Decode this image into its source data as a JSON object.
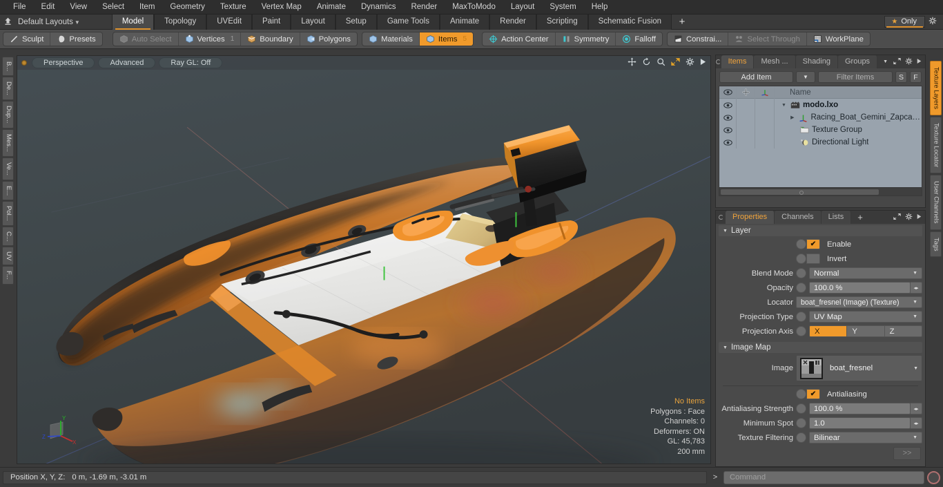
{
  "menubar": {
    "items": [
      "File",
      "Edit",
      "View",
      "Select",
      "Item",
      "Geometry",
      "Texture",
      "Vertex Map",
      "Animate",
      "Dynamics",
      "Render",
      "MaxToModo",
      "Layout",
      "System",
      "Help"
    ]
  },
  "layoutbar": {
    "home_icon": "home-icon",
    "layout_name": "Default Layouts",
    "tabs": [
      "Model",
      "Topology",
      "UVEdit",
      "Paint",
      "Layout",
      "Setup",
      "Game Tools",
      "Animate",
      "Render",
      "Scripting",
      "Schematic Fusion"
    ],
    "active_tab": "Model",
    "plus_label": "+",
    "only_label": "Only",
    "gear_icon": "gear-icon"
  },
  "modebar": {
    "left_group": [
      {
        "label": "Sculpt",
        "icon": "brush-icon",
        "state": "normal"
      },
      {
        "label": "Presets",
        "icon": "sphere-icon",
        "state": "normal"
      }
    ],
    "select_group": [
      {
        "label": "Auto Select",
        "icon": "cube-gray-icon",
        "state": "dim",
        "num": ""
      },
      {
        "label": "Vertices",
        "icon": "cube-vertex-icon",
        "state": "normal",
        "num": "1"
      },
      {
        "label": "Boundary",
        "icon": "cube-edge-icon",
        "state": "normal",
        "num": ""
      },
      {
        "label": "Polygons",
        "icon": "cube-poly-icon",
        "state": "normal",
        "num": ""
      }
    ],
    "item_group": [
      {
        "label": "Materials",
        "icon": "cube-mat-icon",
        "state": "normal",
        "num": ""
      },
      {
        "label": "Items",
        "icon": "cube-item-icon",
        "state": "on",
        "num": "5"
      }
    ],
    "tool_group": [
      {
        "label": "Action Center",
        "icon": "action-center-icon",
        "state": "normal"
      },
      {
        "label": "Symmetry",
        "icon": "symmetry-icon",
        "state": "normal"
      },
      {
        "label": "Falloff",
        "icon": "falloff-icon",
        "state": "normal"
      }
    ],
    "constraint_group": [
      {
        "label": "Constrai...",
        "icon": "constraint-icon",
        "state": "normal"
      },
      {
        "label": "Select Through",
        "icon": "select-through-icon",
        "state": "dim"
      },
      {
        "label": "WorkPlane",
        "icon": "workplane-icon",
        "state": "normal"
      }
    ]
  },
  "left_tabs": [
    "B...",
    "De...",
    "Dup...",
    "Mes...",
    "Ve...",
    "E...",
    "Pol...",
    "C...",
    "UV",
    "F..."
  ],
  "viewport": {
    "dot": "viewport-indicator",
    "buttons": [
      "Perspective",
      "Advanced",
      "Ray GL: Off"
    ],
    "icons": [
      "move-icon",
      "rotate-icon",
      "zoom-icon",
      "maximize-icon",
      "gear-icon",
      "play-icon"
    ],
    "stats": [
      "No Items",
      "Polygons : Face",
      "Channels: 0",
      "Deformers: ON",
      "GL: 45,783",
      "200 mm"
    ],
    "stats_highlight": "No Items",
    "axis_labels": {
      "x": "X",
      "y": "Y",
      "z": "Z"
    }
  },
  "items_panel": {
    "tabs": [
      "Items",
      "Mesh ...",
      "Shading",
      "Groups"
    ],
    "active_tab": "Items",
    "more_caret": "▼",
    "icons": [
      "expand-icon",
      "gear-icon",
      "arrow-right-icon"
    ],
    "add_item_label": "Add Item",
    "add_caret": "▼",
    "filter_placeholder": "Filter Items",
    "s_button": "S",
    "f_button": "F",
    "columns": [
      "eye-icon",
      "move-icon",
      "axis-icon",
      "Name"
    ],
    "rows": [
      {
        "name": "modo.lxo",
        "icon": "scene-icon",
        "indent": 0,
        "bold": true,
        "expander": "▼"
      },
      {
        "name": "Racing_Boat_Gemini_Zapcat_F...",
        "icon": "mesh-axis-icon",
        "indent": 1,
        "bold": false,
        "expander": "▶"
      },
      {
        "name": "Texture Group",
        "icon": "texture-group-icon",
        "indent": 1,
        "bold": false,
        "expander": ""
      },
      {
        "name": "Directional Light",
        "icon": "light-icon",
        "indent": 1,
        "bold": false,
        "expander": ""
      }
    ]
  },
  "properties_panel": {
    "tabs": [
      "Properties",
      "Channels",
      "Lists"
    ],
    "active_tab": "Properties",
    "plus_label": "+",
    "icons": [
      "expand-icon",
      "gear-icon",
      "arrow-right-icon"
    ],
    "layer_section": {
      "title": "Layer",
      "enable": {
        "label": "Enable",
        "checked": true
      },
      "invert": {
        "label": "Invert",
        "checked": false
      },
      "blend_mode": {
        "label": "Blend Mode",
        "value": "Normal"
      },
      "opacity": {
        "label": "Opacity",
        "value": "100.0 %"
      },
      "locator": {
        "label": "Locator",
        "value": "boat_fresnel (Image) (Texture)"
      },
      "projection_type": {
        "label": "Projection Type",
        "value": "UV Map"
      },
      "projection_axis": {
        "label": "Projection Axis",
        "options": [
          "X",
          "Y",
          "Z"
        ],
        "selected": "X"
      }
    },
    "image_map_section": {
      "title": "Image Map",
      "image": {
        "label": "Image",
        "value": "boat_fresnel",
        "thumb": "image-thumb"
      },
      "antialiasing": {
        "label": "Antialiasing",
        "checked": true
      },
      "antialiasing_strength": {
        "label": "Antialiasing Strength",
        "value": "100.0 %"
      },
      "minimum_spot": {
        "label": "Minimum Spot",
        "value": "1.0"
      },
      "texture_filtering": {
        "label": "Texture Filtering",
        "value": "Bilinear"
      },
      "more_button": ">>"
    }
  },
  "right_tabs": [
    {
      "label": "Texture Layers",
      "active": true
    },
    {
      "label": "Texture Locator",
      "active": false
    },
    {
      "label": "User Channels",
      "active": false
    },
    {
      "label": "Tags",
      "active": false
    }
  ],
  "statusbar": {
    "position_label": "Position X, Y, Z:",
    "position_value": "0 m, -1.69 m, -3.01 m",
    "command_arrow": ">",
    "command_placeholder": "Command",
    "record_icon": "record-icon"
  },
  "colors": {
    "accent_orange": "#f09a2b",
    "viewport_bg": "#414a4e",
    "panel_bg": "#3b3b3b",
    "tree_bg": "#99a3ad"
  }
}
